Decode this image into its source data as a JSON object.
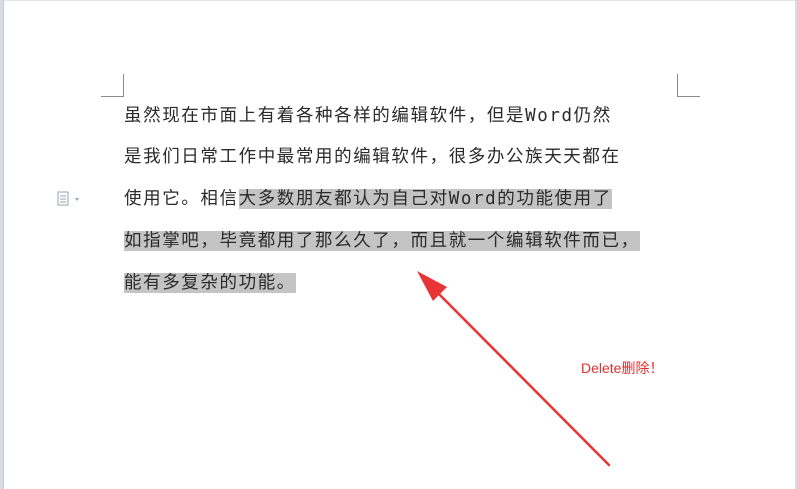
{
  "document": {
    "lines": [
      {
        "plain": "虽然现在市面上有着各种各样的编辑软件，但是Word仍然",
        "selected": ""
      },
      {
        "plain": "是我们日常工作中最常用的编辑软件，很多办公族天天都在",
        "selected": ""
      },
      {
        "plain": "使用它。相信",
        "selected": "大多数朋友都认为自己对Word的功能使用了"
      },
      {
        "plain": "",
        "selected": "如指掌吧，毕竟都用了那么久了，而且就一个编辑软件而已，"
      },
      {
        "plain": "",
        "selected": "能有多复杂的功能。"
      }
    ]
  },
  "annotation": {
    "text": "Delete删除！",
    "color": "#e03030"
  },
  "icons": {
    "paste_options": "paste-options-icon"
  },
  "colors": {
    "selection": "#c4c4c4",
    "text": "#2a2a2a",
    "frame": "#d9dce3"
  }
}
